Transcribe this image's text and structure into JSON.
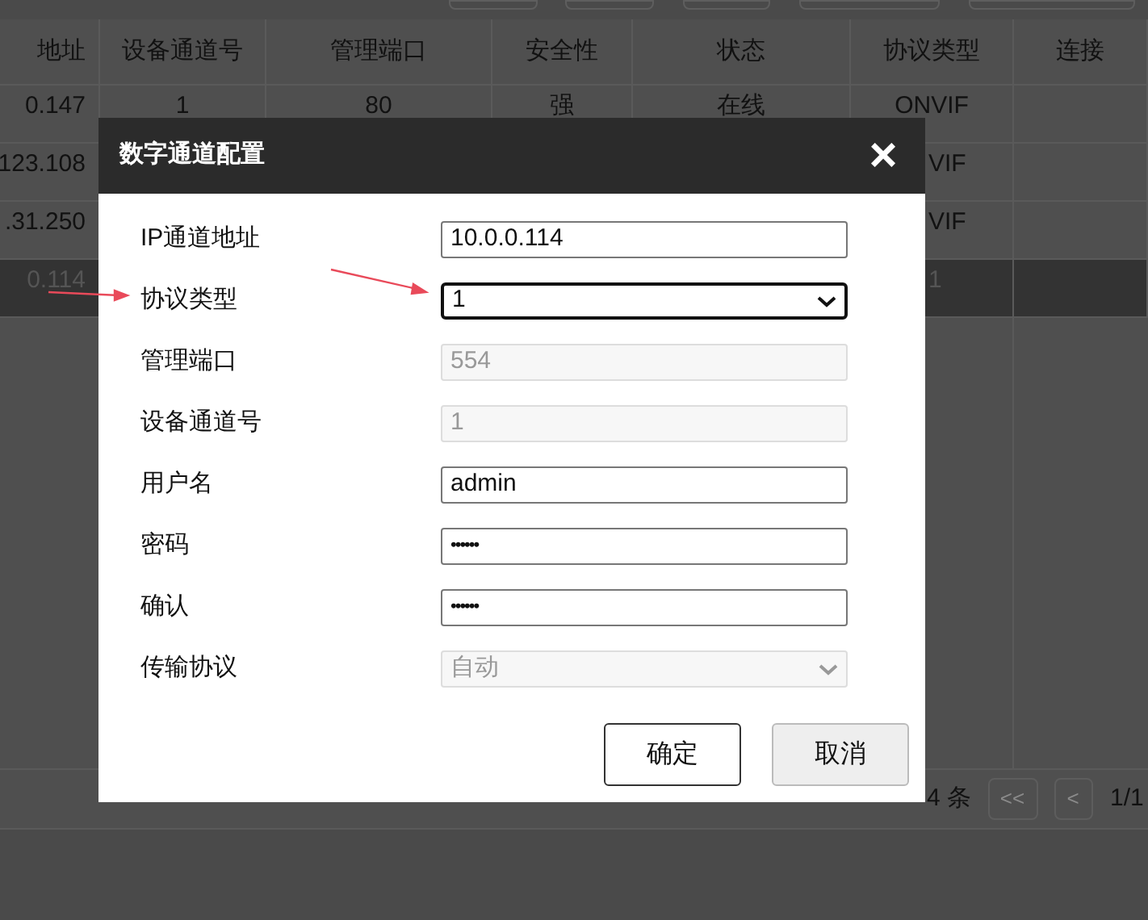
{
  "table": {
    "columns": [
      "地址",
      "设备通道号",
      "管理端口",
      "安全性",
      "状态",
      "协议类型",
      "连接"
    ],
    "rows": [
      {
        "selected": false,
        "cells": [
          "0.147",
          "1",
          "80",
          "强",
          "在线",
          "ONVIF",
          ""
        ]
      },
      {
        "selected": false,
        "cells": [
          "123.108",
          "",
          "",
          "",
          "",
          "VIF",
          ""
        ]
      },
      {
        "selected": false,
        "cells": [
          ".31.250",
          "",
          "",
          "",
          "",
          "VIF",
          ""
        ]
      },
      {
        "selected": true,
        "cells": [
          "0.114",
          "",
          "",
          "",
          "",
          "1",
          ""
        ]
      }
    ]
  },
  "pager": {
    "count": "4 条",
    "first": "<<",
    "prev": "<",
    "page": "1/1"
  },
  "dialog": {
    "title": "数字通道配置",
    "close": "×",
    "fields": [
      {
        "label": "IP通道地址",
        "kind": "text",
        "value": "10.0.0.114",
        "disabled": false,
        "focused": false
      },
      {
        "label": "协议类型",
        "kind": "select",
        "value": "1",
        "disabled": false,
        "focused": true
      },
      {
        "label": "管理端口",
        "kind": "text",
        "value": "554",
        "disabled": true,
        "focused": false
      },
      {
        "label": "设备通道号",
        "kind": "text",
        "value": "1",
        "disabled": true,
        "focused": false
      },
      {
        "label": "用户名",
        "kind": "text",
        "value": "admin",
        "disabled": false,
        "focused": false
      },
      {
        "label": "密码",
        "kind": "password",
        "value": "••••••",
        "disabled": false,
        "focused": false
      },
      {
        "label": "确认",
        "kind": "password",
        "value": "••••••",
        "disabled": false,
        "focused": false
      },
      {
        "label": "传输协议",
        "kind": "select",
        "value": "自动",
        "disabled": true,
        "focused": false
      }
    ],
    "buttons": [
      {
        "label": "确定",
        "kind": "primary"
      },
      {
        "label": "取消",
        "kind": "secondary"
      }
    ]
  }
}
